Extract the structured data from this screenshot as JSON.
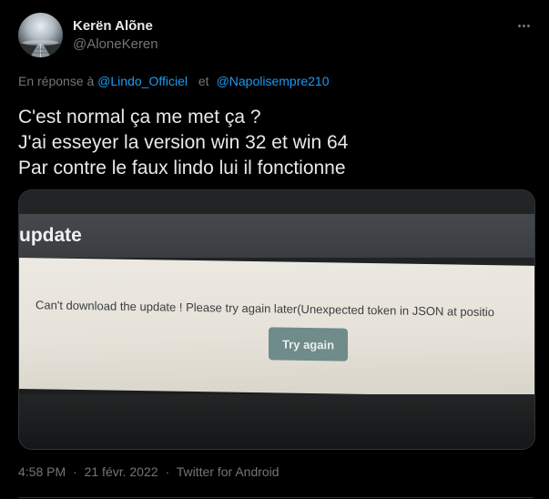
{
  "author": {
    "name": "Kerën Alõne",
    "handle": "@AloneKeren",
    "avatar_icon": "avatar-photo-railroad"
  },
  "reply": {
    "prefix": "En réponse à",
    "mention_1": "@Lindo_Officiel",
    "separator": "et",
    "mention_2": "@Napolisempre210"
  },
  "tweet": {
    "lines": [
      "C'est normal ça me met ça ?",
      "J'ai esseyer la version win 32 et win 64",
      "Par contre le faux lindo lui il fonctionne"
    ]
  },
  "media": {
    "header_title": "update",
    "error_message": "Can't download the update ! Please try again later(Unexpected token  in JSON at positio",
    "button_label": "Try again"
  },
  "meta": {
    "time": "4:58 PM",
    "date": "21 févr. 2022",
    "separator": "·",
    "source": "Twitter for Android"
  },
  "colors": {
    "background": "#000000",
    "text_primary": "#e7e9ea",
    "text_secondary": "#71767b",
    "link": "#1d9bf0",
    "border": "#2f3336",
    "photo_button": "#6f8b8a"
  }
}
